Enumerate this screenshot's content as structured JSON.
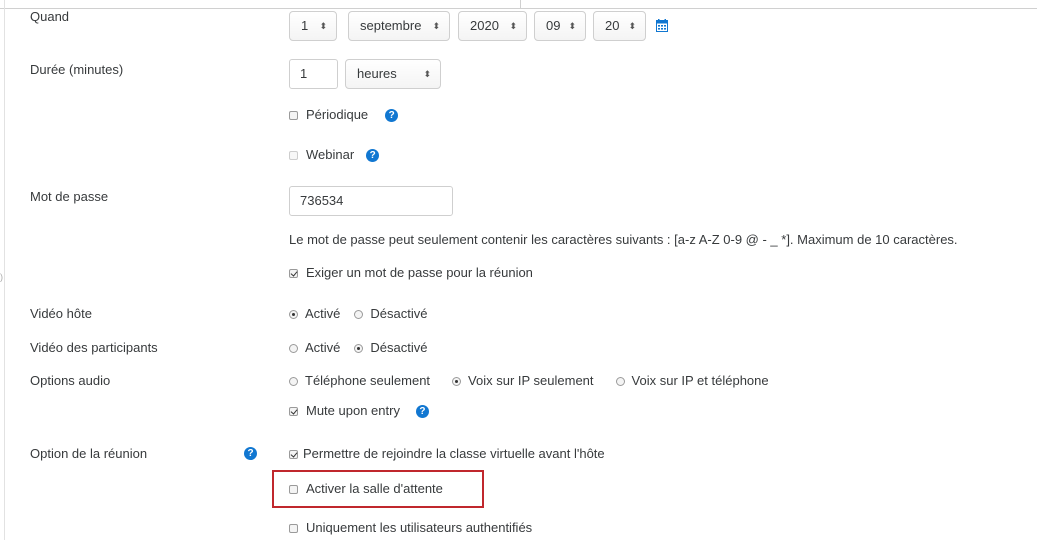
{
  "form": {
    "quand": {
      "label": "Quand",
      "day": "1",
      "month": "septembre",
      "year": "2020",
      "hour": "09",
      "minute": "20"
    },
    "duree": {
      "label": "Durée (minutes)",
      "value": "1",
      "unit": "heures"
    },
    "periodique": {
      "label": "Périodique",
      "checked": false
    },
    "webinar": {
      "label": "Webinar",
      "checked": false,
      "disabled": true
    },
    "mot_de_passe": {
      "label": "Mot de passe",
      "value": "736534",
      "hint": "Le mot de passe peut seulement contenir les caractères suivants : [a-z A-Z 0-9 @ - _ *]. Maximum de 10 caractères.",
      "require_label": "Exiger un mot de passe pour la réunion",
      "require_checked": true
    },
    "video_hote": {
      "label": "Vidéo hôte",
      "options": [
        "Activé",
        "Désactivé"
      ],
      "selected": "Activé"
    },
    "video_participants": {
      "label": "Vidéo des participants",
      "options": [
        "Activé",
        "Désactivé"
      ],
      "selected": "Désactivé"
    },
    "options_audio": {
      "label": "Options audio",
      "options": [
        "Téléphone seulement",
        "Voix sur IP seulement",
        "Voix sur IP et téléphone"
      ],
      "selected": "Voix sur IP seulement",
      "mute_label": "Mute upon entry",
      "mute_checked": true
    },
    "option_reunion": {
      "label": "Option de la réunion",
      "join_before_host_label": "Permettre de rejoindre la classe virtuelle avant l'hôte",
      "join_before_host_checked": true,
      "waiting_room_label": "Activer la salle d'attente",
      "waiting_room_checked": false,
      "auth_only_label": "Uniquement les utilisateurs authentifiés",
      "auth_only_checked": false
    }
  },
  "icons": {
    "help": "question-circle-icon",
    "calendar": "calendar-icon",
    "select_arrows": "sort-arrows-icon"
  },
  "glyphs": {
    "help": "?",
    "arrows": "▲▼"
  },
  "colors": {
    "accent": "#1177d1",
    "highlight_border": "#c0272d",
    "text": "#373a3c"
  }
}
